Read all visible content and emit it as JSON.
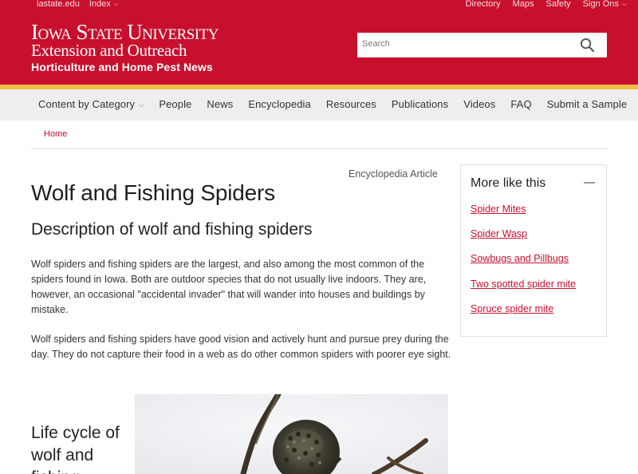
{
  "topbar": {
    "left_links": [
      "iastate.edu",
      "Index"
    ],
    "right_links": [
      "Directory",
      "Maps",
      "Safety",
      "Sign Ons"
    ]
  },
  "header": {
    "university": "Iowa State University",
    "unit": "Extension and Outreach",
    "site_name": "Horticulture and Home Pest News",
    "search_placeholder": "Search"
  },
  "nav": {
    "items": [
      "Content by Category",
      "People",
      "News",
      "Encyclopedia",
      "Resources",
      "Publications",
      "Videos",
      "FAQ",
      "Submit a Sample"
    ]
  },
  "breadcrumb": {
    "home": "Home"
  },
  "article": {
    "kind": "Encyclopedia Article",
    "title": "Wolf and Fishing Spiders",
    "subtitle": "Description of wolf and fishing spiders",
    "paragraphs": [
      "Wolf spiders and fishing spiders are the largest, and also among the most common of the spiders found in Iowa. Both are outdoor species that do not usually live indoors. They are, however, an occasional \"accidental invader\" that will wander into houses and buildings by mistake.",
      "Wolf spiders and fishing spiders have good vision and actively hunt and pursue prey during the day. They do not capture their food in a web as do other common spiders with poorer eye sight."
    ],
    "section_heading": "Life cycle of wolf and fishing"
  },
  "sidebar": {
    "heading": "More like this",
    "links": [
      "Spider Mites",
      "Spider Wasp",
      "Sowbugs and Pillbugs",
      "Two spotted spider mite",
      "Spruce spider mite"
    ]
  },
  "colors": {
    "brand_red": "#c8102e",
    "gold": "#f1be48",
    "nav_bg": "#eeeeee"
  }
}
